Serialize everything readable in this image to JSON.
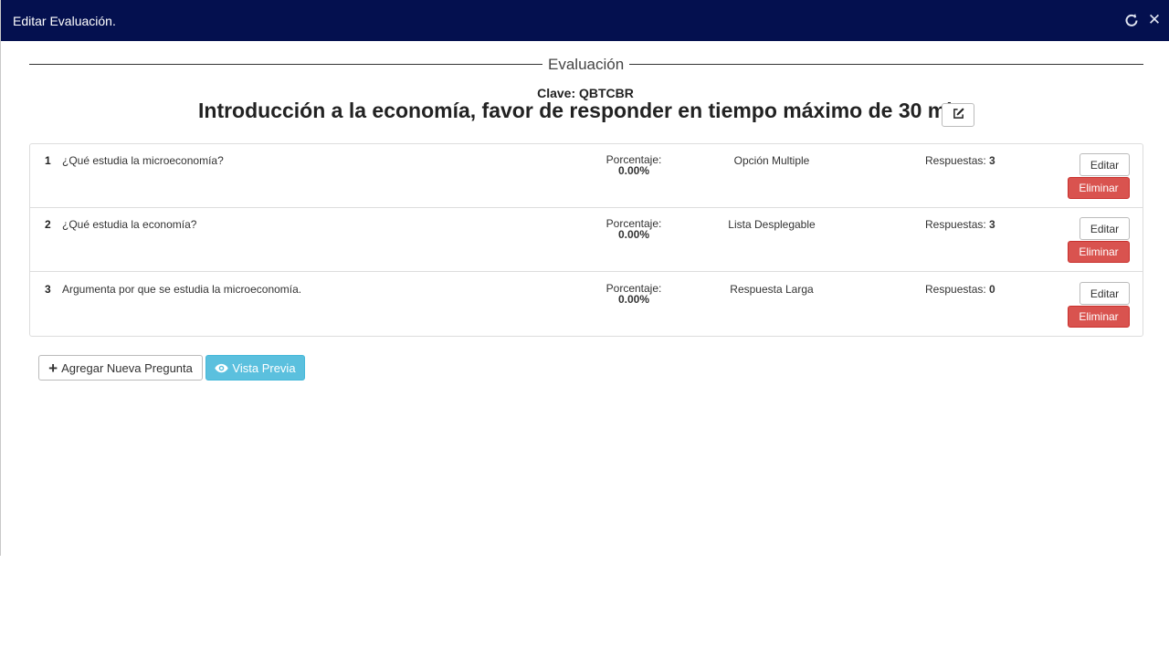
{
  "window": {
    "title": "Editar Evaluación.",
    "refresh_icon": "refresh-icon",
    "close_icon": "close-icon",
    "colors": {
      "titlebar": "#04104f",
      "danger": "#d9534f",
      "info": "#5bc0de"
    }
  },
  "evaluation": {
    "legend": "Evaluación",
    "clave_label": "Clave: QBTCBR",
    "title": "Introducción a la economía, favor de responder en tiempo máximo de 30 min.",
    "edit_icon": "edit-icon"
  },
  "questions": [
    {
      "number": "1",
      "text": "¿Qué estudia la microeconomía?",
      "pct_label": "Porcentaje:",
      "pct_value": "0.00%",
      "type": "Opción Multiple",
      "resp_label": "Respuestas:",
      "resp_count": "3",
      "edit_label": "Editar",
      "delete_label": "Eliminar"
    },
    {
      "number": "2",
      "text": "¿Qué estudia la economía?",
      "pct_label": "Porcentaje:",
      "pct_value": "0.00%",
      "type": "Lista Desplegable",
      "resp_label": "Respuestas:",
      "resp_count": "3",
      "edit_label": "Editar",
      "delete_label": "Eliminar"
    },
    {
      "number": "3",
      "text": "Argumenta por que se estudia la microeconomía.",
      "pct_label": "Porcentaje:",
      "pct_value": "0.00%",
      "type": "Respuesta Larga",
      "resp_label": "Respuestas:",
      "resp_count": "0",
      "edit_label": "Editar",
      "delete_label": "Eliminar"
    }
  ],
  "actions": {
    "add_label": "Agregar Nueva Pregunta",
    "add_icon": "plus-icon",
    "preview_label": "Vista Previa",
    "preview_icon": "eye-icon"
  }
}
